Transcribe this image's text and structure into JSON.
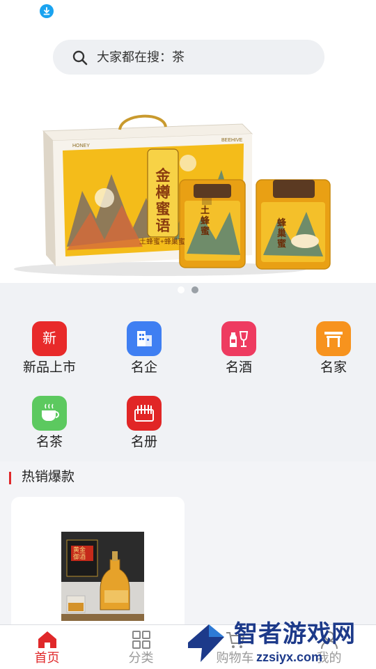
{
  "status": {
    "download_icon": "download-icon"
  },
  "search": {
    "prefix": "大家都在搜：",
    "keyword": "茶",
    "icon": "search-icon"
  },
  "banner": {
    "product_name": "金樽蜜语",
    "product_sub": "土蜂蜜+蜂巢蜜",
    "jar1_label": "土蜂蜜",
    "jar2_label": "蜂巢蜜",
    "brand_left": "HONEY",
    "brand_right": "BEEHIVE",
    "active_dot": 1,
    "dot_count": 2
  },
  "categories": [
    {
      "label": "新品上市",
      "icon_text": "新",
      "icon": "new-products-icon",
      "color": "#e82a2a"
    },
    {
      "label": "名企",
      "icon": "building-icon",
      "color": "#3f7ff2"
    },
    {
      "label": "名酒",
      "icon": "wine-icon",
      "color": "#ee3b60"
    },
    {
      "label": "名家",
      "icon": "gate-icon",
      "color": "#f7931e"
    },
    {
      "label": "名茶",
      "icon": "tea-cup-icon",
      "color": "#5cc95f"
    },
    {
      "label": "名册",
      "icon": "register-icon",
      "color": "#e12626"
    }
  ],
  "hot_section": {
    "title": "热销爆款",
    "product_caption": "黄金御酒"
  },
  "tabbar": [
    {
      "label": "首页",
      "icon": "home-icon",
      "active": true
    },
    {
      "label": "分类",
      "icon": "grid-icon",
      "active": false
    },
    {
      "label": "购物车",
      "icon": "cart-icon",
      "active": false
    },
    {
      "label": "我的",
      "icon": "user-icon",
      "active": false
    }
  ],
  "watermark": {
    "title": "智者游戏网",
    "sub": "zzsiyx.com",
    "logo": "zz-logo-icon"
  },
  "colors": {
    "accent": "#e0282a",
    "honey": "#f2b51c"
  }
}
